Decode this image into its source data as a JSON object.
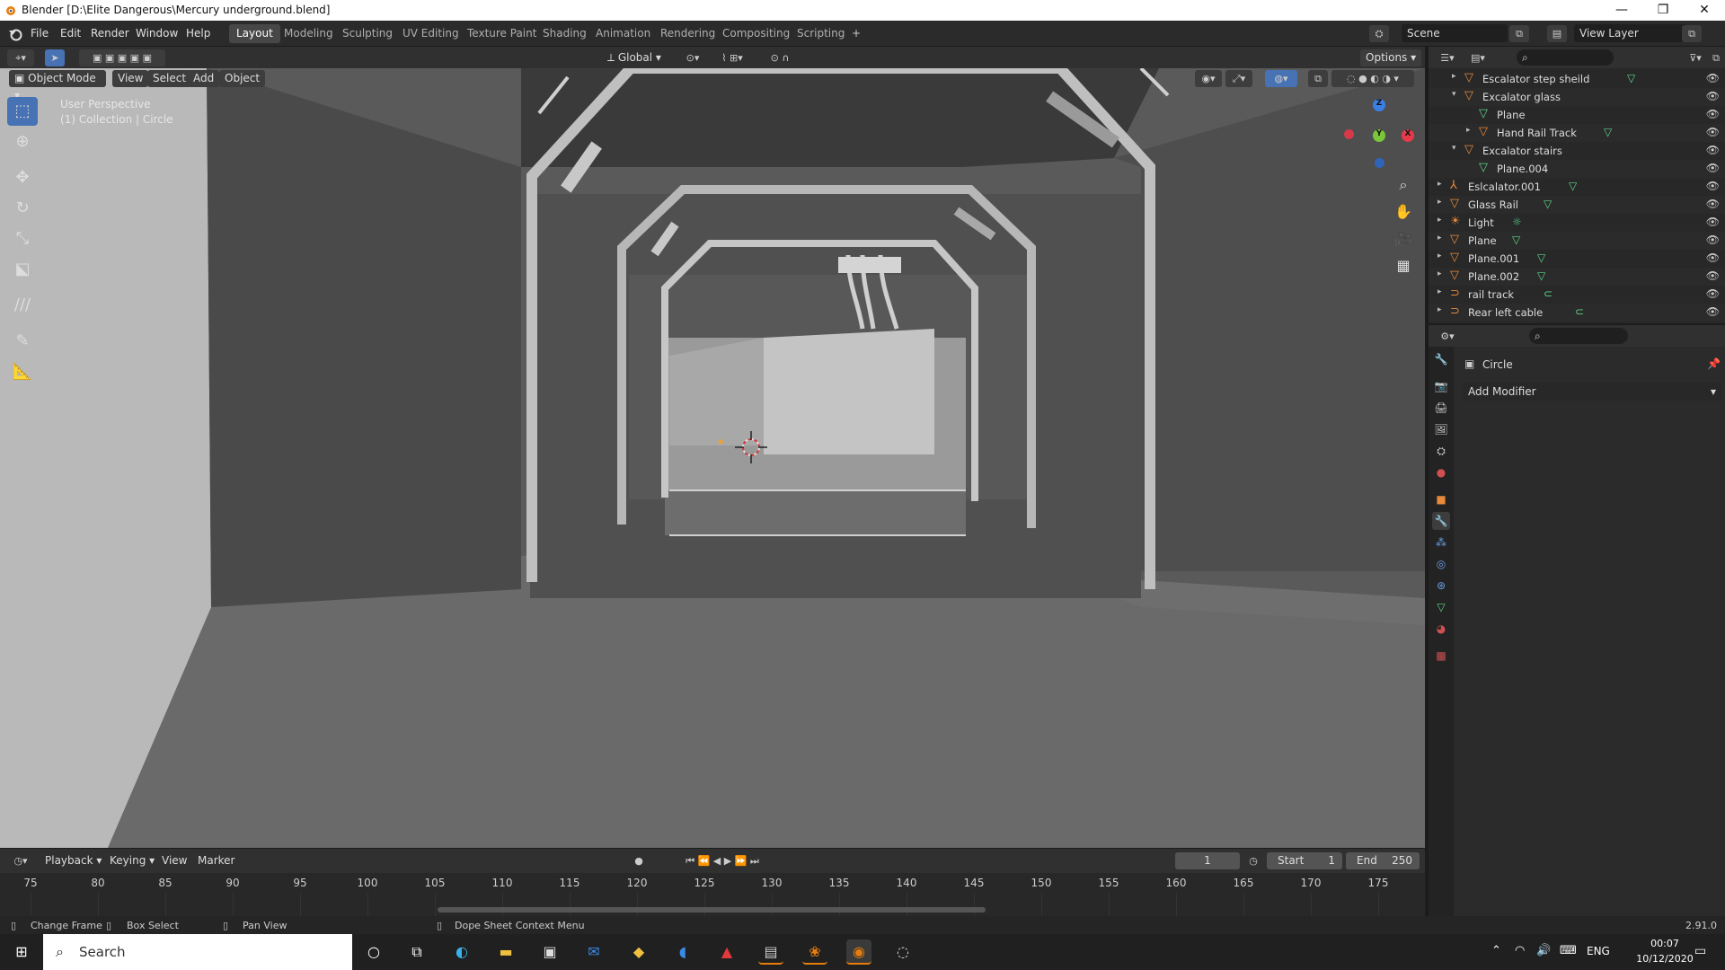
{
  "window": {
    "title": "Blender [D:\\Elite Dangerous\\Mercury underground.blend]",
    "minimize": "—",
    "maximize": "❐",
    "close": "✕"
  },
  "menubar": {
    "items": [
      "File",
      "Edit",
      "Render",
      "Window",
      "Help"
    ],
    "workspaces": [
      "Layout",
      "Modeling",
      "Sculpting",
      "UV Editing",
      "Texture Paint",
      "Shading",
      "Animation",
      "Rendering",
      "Compositing",
      "Scripting"
    ],
    "active_workspace": "Layout",
    "add_tab": "+",
    "scene": "Scene",
    "view_layer": "View Layer"
  },
  "viewport_header": {
    "transform_orientation": "Global",
    "options": "Options",
    "mode": "Object Mode",
    "menus": [
      "View",
      "Select",
      "Add",
      "Object"
    ]
  },
  "viewport": {
    "perspective": "User Perspective",
    "collection": "(1) Collection | Circle",
    "gizmo": {
      "x": "X",
      "y": "Y",
      "z": "Z"
    }
  },
  "outliner": {
    "rows": [
      {
        "label": "Escalator step sheild",
        "indent": 3,
        "expand": "▸",
        "type": "mesh",
        "data": true
      },
      {
        "label": "Excalator glass",
        "indent": 3,
        "expand": "▾",
        "type": "mesh",
        "data": false
      },
      {
        "label": "Plane",
        "indent": 4,
        "expand": "",
        "type": "meshdata",
        "data": false
      },
      {
        "label": "Hand Rail Track",
        "indent": 4,
        "expand": "▸",
        "type": "mesh",
        "data": true
      },
      {
        "label": "Excalator stairs",
        "indent": 3,
        "expand": "▾",
        "type": "mesh",
        "data": false
      },
      {
        "label": "Plane.004",
        "indent": 4,
        "expand": "",
        "type": "meshdata",
        "data": false
      },
      {
        "label": "Eslcalator.001",
        "indent": 2,
        "expand": "▸",
        "type": "empty",
        "data": true
      },
      {
        "label": "Glass Rail",
        "indent": 2,
        "expand": "▸",
        "type": "mesh",
        "data": true
      },
      {
        "label": "Light",
        "indent": 2,
        "expand": "▸",
        "type": "light",
        "data": true
      },
      {
        "label": "Plane",
        "indent": 2,
        "expand": "▸",
        "type": "mesh",
        "data": true
      },
      {
        "label": "Plane.001",
        "indent": 2,
        "expand": "▸",
        "type": "mesh",
        "data": true
      },
      {
        "label": "Plane.002",
        "indent": 2,
        "expand": "▸",
        "type": "mesh",
        "data": true
      },
      {
        "label": "rail track",
        "indent": 2,
        "expand": "▸",
        "type": "curve",
        "data": true
      },
      {
        "label": "Rear left cable",
        "indent": 2,
        "expand": "▸",
        "type": "curve",
        "data": true
      }
    ]
  },
  "properties": {
    "object_name": "Circle",
    "add_modifier": "Add Modifier"
  },
  "timeline": {
    "menus": [
      "Playback",
      "Keying",
      "View",
      "Marker"
    ],
    "current_frame": "1",
    "start_label": "Start",
    "start": "1",
    "end_label": "End",
    "end": "250",
    "ticks": [
      "75",
      "80",
      "85",
      "90",
      "95",
      "100",
      "105",
      "110",
      "115",
      "120",
      "125",
      "130",
      "135",
      "140",
      "145",
      "150",
      "155",
      "160",
      "165",
      "170",
      "175"
    ]
  },
  "statusbar": {
    "change_frame": "Change Frame",
    "box_select": "Box Select",
    "pan_view": "Pan View",
    "context_menu": "Dope Sheet Context Menu",
    "version": "2.91.0"
  },
  "taskbar": {
    "search": "Search",
    "lang": "ENG",
    "time": "00:07",
    "date": "10/12/2020"
  },
  "colors": {
    "accent": "#4772b3",
    "outliner_icon": "#e88a3a",
    "data_icon": "#5dd38a",
    "x_axis": "#e63a4a",
    "y_axis": "#7ac63a",
    "z_axis": "#3a7fe6"
  }
}
